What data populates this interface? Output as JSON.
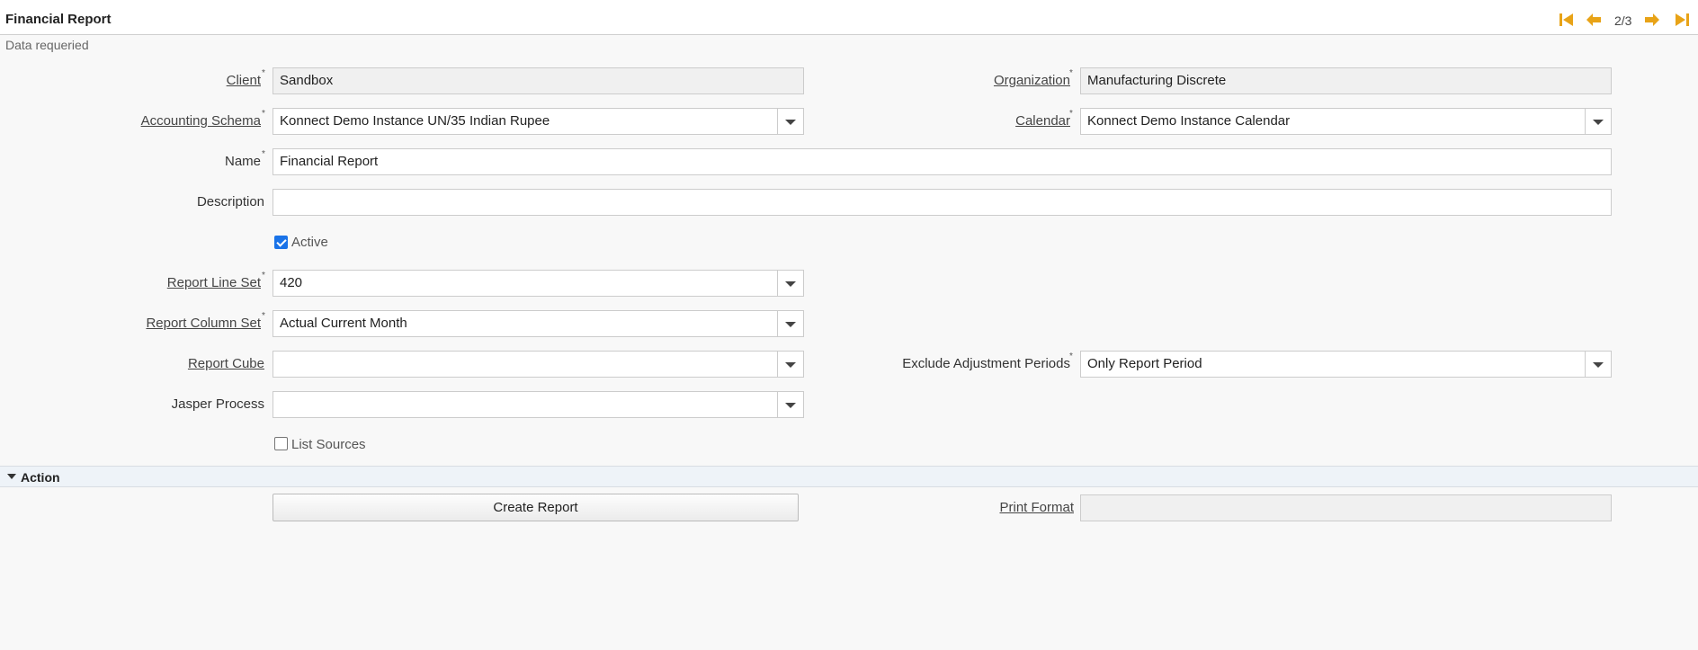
{
  "window": {
    "title": "Financial Report",
    "subtitle": "Data requeried"
  },
  "navigation": {
    "pager": "2/3",
    "icons": [
      "first-record-icon",
      "previous-record-icon",
      "next-record-icon",
      "last-record-icon"
    ],
    "accent_color": "#e8a317"
  },
  "form": {
    "client": {
      "label": "Client",
      "value": "Sandbox",
      "required": "*"
    },
    "organization": {
      "label": "Organization",
      "value": "Manufacturing Discrete",
      "required": "*"
    },
    "accounting_schema": {
      "label": "Accounting Schema",
      "value": "Konnect Demo Instance UN/35 Indian Rupee",
      "required": "*"
    },
    "calendar": {
      "label": "Calendar",
      "value": "Konnect Demo Instance Calendar",
      "required": "*"
    },
    "name": {
      "label": "Name",
      "value": "Financial Report",
      "required": "*"
    },
    "description": {
      "label": "Description",
      "value": ""
    },
    "active": {
      "label": "Active",
      "checked": true
    },
    "report_line_set": {
      "label": "Report Line Set",
      "value": "420",
      "required": "*"
    },
    "report_column_set": {
      "label": "Report Column Set",
      "value": "Actual Current Month",
      "required": "*"
    },
    "report_cube": {
      "label": "Report Cube",
      "value": ""
    },
    "exclude_adjustment_periods": {
      "label": "Exclude Adjustment Periods",
      "value": "Only Report Period",
      "required": "*"
    },
    "jasper_process": {
      "label": "Jasper Process",
      "value": ""
    },
    "list_sources": {
      "label": "List Sources",
      "checked": false
    }
  },
  "action_section": {
    "title": "Action",
    "create_report_label": "Create Report",
    "print_format": {
      "label": "Print Format",
      "value": ""
    }
  }
}
